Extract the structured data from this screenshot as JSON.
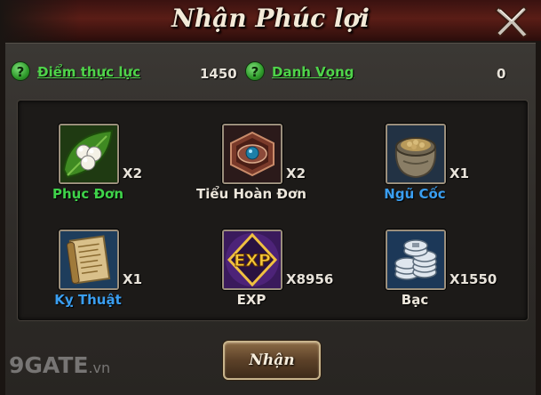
{
  "dialog": {
    "title": "Nhận Phúc lợi",
    "claim_label": "Nhận"
  },
  "stats": {
    "strength_label": "Điểm thực lực",
    "strength_value": "1450",
    "prestige_label": "Danh Vọng",
    "prestige_value": "0",
    "help_glyph": "?"
  },
  "rewards": [
    {
      "name": "Phục Đơn",
      "qty": "X2",
      "name_color": "green",
      "icon": "pearl-leaf-icon"
    },
    {
      "name": "Tiểu Hoàn Đơn",
      "qty": "X2",
      "name_color": "white",
      "icon": "pill-box-icon"
    },
    {
      "name": "Ngũ Cốc",
      "qty": "X1",
      "name_color": "blue",
      "icon": "grain-sack-icon"
    },
    {
      "name": "Kỵ Thuật",
      "qty": "X1",
      "name_color": "blue",
      "icon": "scroll-icon"
    },
    {
      "name": "EXP",
      "qty": "X8956",
      "name_color": "white",
      "icon": "exp-badge-icon"
    },
    {
      "name": "Bạc",
      "qty": "X1550",
      "name_color": "white",
      "icon": "silver-coins-icon"
    }
  ],
  "watermark": {
    "brand": "9GATE",
    "suffix": ".vn"
  }
}
